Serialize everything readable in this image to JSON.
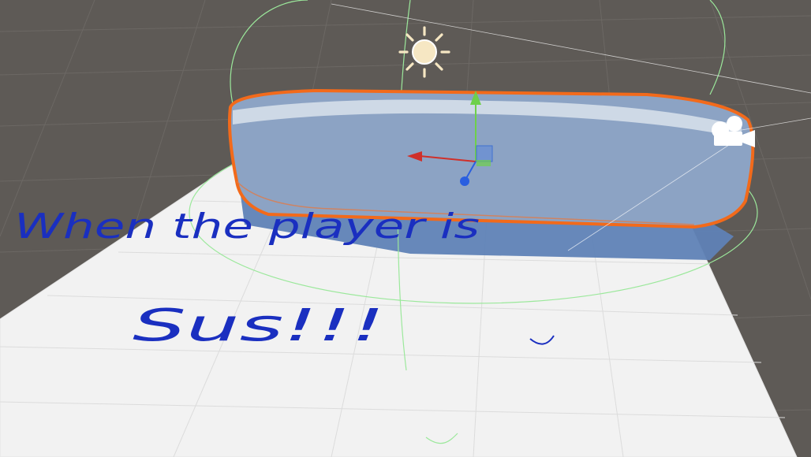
{
  "scene": {
    "background_color": "#5e5a56",
    "grid_color": "#6c6864",
    "plane_color": "#f2f2f2",
    "selection_outline_color": "#f26a1b",
    "collider_gizmo_color": "#9be89b",
    "sun_icon": "sun-icon",
    "camera_icon": "camera-icon",
    "gizmo": {
      "x_axis_color": "#d0302a",
      "y_axis_color": "#6ed04a",
      "z_axis_color": "#2a5fe0"
    }
  },
  "annotation": {
    "ink_color": "#1a2fc0",
    "line1": "When the player is",
    "line2": "Sus!!!"
  }
}
